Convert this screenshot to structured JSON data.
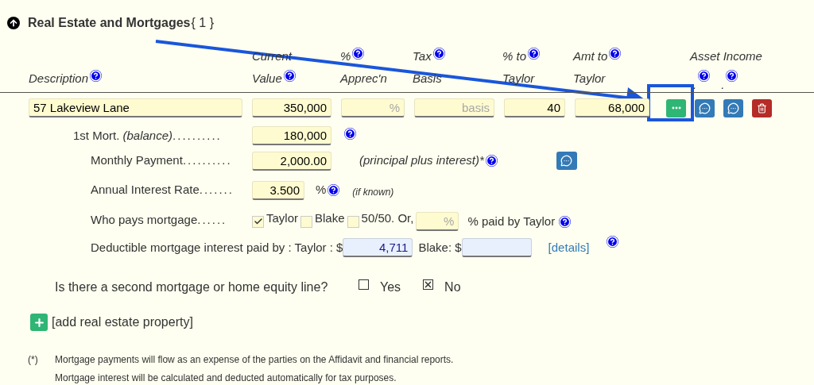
{
  "section": {
    "title": "Real Estate and Mortgages",
    "count": "{ 1 }",
    "expanded": true
  },
  "columns": [
    {
      "lines": [
        {
          "kind": "label_help",
          "text": "Description"
        }
      ]
    },
    {
      "lines": [
        {
          "kind": "label",
          "text": "Current"
        },
        {
          "kind": "label_help",
          "text": "Value"
        }
      ]
    },
    {
      "lines": [
        {
          "kind": "label_help",
          "text": "%"
        },
        {
          "kind": "label",
          "text": "Apprec'n"
        }
      ]
    },
    {
      "lines": [
        {
          "kind": "label_help",
          "text": "Tax"
        },
        {
          "kind": "label",
          "text": "Basis"
        }
      ]
    },
    {
      "lines": [
        {
          "kind": "label_help",
          "text": "% to"
        },
        {
          "kind": "label",
          "text": "Taylor"
        }
      ]
    },
    {
      "lines": [
        {
          "kind": "label_help",
          "text": "Amt to"
        },
        {
          "kind": "label",
          "text": "Taylor"
        }
      ]
    }
  ],
  "income_header": {
    "title": "Asset Income",
    "marks": [
      ".",
      "."
    ]
  },
  "property": {
    "description": "57 Lakeview Lane",
    "value": "350,000",
    "apprec_placeholder": "%",
    "basis_placeholder": "basis",
    "pct_to_taylor": "40",
    "amt_to_taylor": "68,000",
    "actions": [
      {
        "kind": "more"
      },
      {
        "kind": "comment"
      },
      {
        "kind": "comment"
      },
      {
        "kind": "delete"
      }
    ]
  },
  "mortgage": {
    "balance": {
      "label": "1st Mort. *(balance)*",
      "dots": "..........",
      "value": "180,000"
    },
    "payment": {
      "label": "Monthly Payment",
      "dots": "..........",
      "value": "2,000.00",
      "note": "(principal plus interest)*"
    },
    "rate": {
      "label": "Annual Interest Rate",
      "dots": ".......",
      "value": "3.500",
      "unit": "%",
      "note": "(if known)"
    },
    "payer": {
      "label": "Who pays mortgage",
      "dots": "......",
      "options": [
        {
          "label": "Taylor",
          "checked": true
        },
        {
          "label": "Blake",
          "checked": false
        },
        {
          "label": "50/50. Or,",
          "checked": false
        }
      ],
      "pct_placeholder": "%",
      "suffix": "% paid by Taylor"
    },
    "deductible": {
      "label": "Deductible mortgage interest paid by : Taylor : $",
      "taylor": "4,711",
      "blake_label": "Blake: $",
      "link": "[details]"
    }
  },
  "second_mortgage": {
    "question": "Is there a second mortgage or home equity line?",
    "options": [
      {
        "label": "Yes",
        "checked": false
      },
      {
        "label": "No",
        "checked": true
      }
    ]
  },
  "add_link": "[add real estate property]",
  "footnote": {
    "marker": "(*)",
    "lines": [
      "Mortgage payments will flow as an expense of the parties on the Affidavit and financial reports.",
      "Mortgage interest will be calculated and deducted automatically for tax purposes."
    ]
  }
}
